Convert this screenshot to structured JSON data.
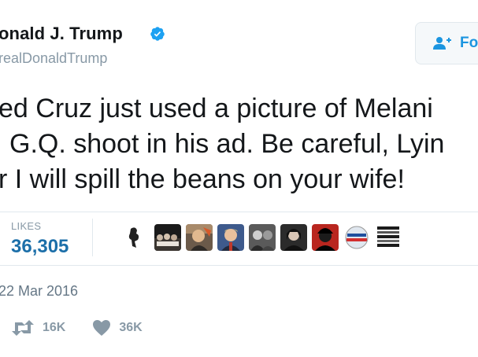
{
  "tweet": {
    "author_name": "onald J. Trump",
    "author_handle": "realDonaldTrump",
    "follow_label": "Fo",
    "text_lines": [
      "ed Cruz just used a picture of Melani",
      "G.Q. shoot in his ad. Be careful, Lyin",
      "r I will spill the beans on your wife!"
    ],
    "likes_label": "LIKES",
    "likes_count": "36,305",
    "timestamp": "22 Mar 2016",
    "retweet_count": "16K",
    "like_count": "36K"
  },
  "colors": {
    "accent": "#1da1f2",
    "link": "#1c6fa9",
    "muted": "#8899a6",
    "text": "#14171a",
    "border": "#e1e8ed"
  },
  "icons": [
    "verified-badge-icon",
    "follow-person-plus-icon",
    "retweet-icon",
    "heart-icon"
  ]
}
